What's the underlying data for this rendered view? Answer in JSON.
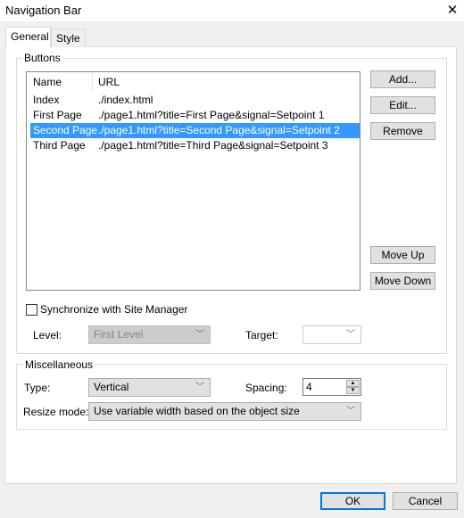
{
  "window": {
    "title": "Navigation Bar",
    "close_icon": "close-icon"
  },
  "tabs": [
    {
      "label": "General",
      "active": true
    },
    {
      "label": "Style",
      "active": false
    }
  ],
  "buttons_group": {
    "label": "Buttons",
    "columns": [
      "Name",
      "URL"
    ],
    "rows": [
      {
        "name": "Index",
        "url": "./index.html",
        "selected": false
      },
      {
        "name": "First Page",
        "url": "./page1.html?title=First Page&signal=Setpoint 1",
        "selected": false
      },
      {
        "name": "Second Page",
        "url": "./page1.html?title=Second Page&signal=Setpoint 2",
        "selected": true
      },
      {
        "name": "Third Page",
        "url": "./page1.html?title=Third Page&signal=Setpoint 3",
        "selected": false
      }
    ],
    "add": "Add...",
    "edit": "Edit...",
    "remove": "Remove",
    "move_up": "Move Up",
    "move_down": "Move Down",
    "sync_label": "Synchronize with Site Manager",
    "sync_checked": false,
    "level_label": "Level:",
    "level_value": "First Level",
    "target_label": "Target:",
    "target_value": ""
  },
  "misc_group": {
    "label": "Miscellaneous",
    "type_label": "Type:",
    "type_value": "Vertical",
    "spacing_label": "Spacing:",
    "spacing_value": "4",
    "resize_label": "Resize mode:",
    "resize_value": "Use variable width based on the object size"
  },
  "footer": {
    "ok": "OK",
    "cancel": "Cancel"
  },
  "colors": {
    "selection": "#3399ff",
    "default_button_border": "#0078d7"
  }
}
